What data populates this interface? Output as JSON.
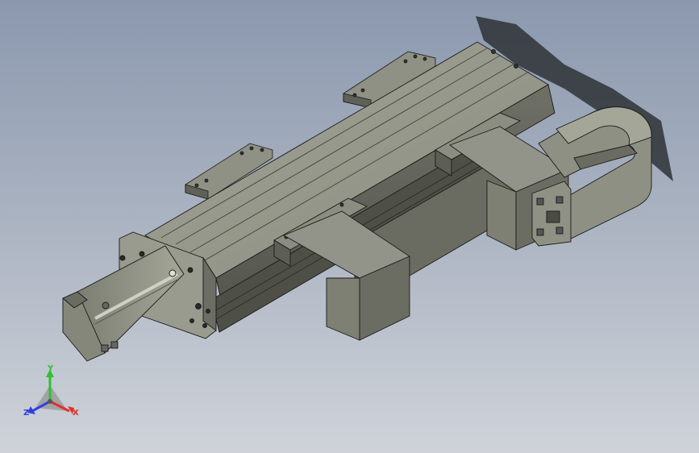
{
  "viewport": {
    "background_top": "#8b98ae",
    "background_bottom": "#cfd3d9"
  },
  "model": {
    "body_color": "#8e9082",
    "body_dark": "#5e6056",
    "body_light": "#b3b5a8",
    "edge_color": "#1a1a1a",
    "shadow_color": "#303538"
  },
  "triad": {
    "x": {
      "label": "X",
      "color": "#e03030"
    },
    "y": {
      "label": "Y",
      "color": "#30c030"
    },
    "z": {
      "label": "Z",
      "color": "#3040e0"
    }
  }
}
